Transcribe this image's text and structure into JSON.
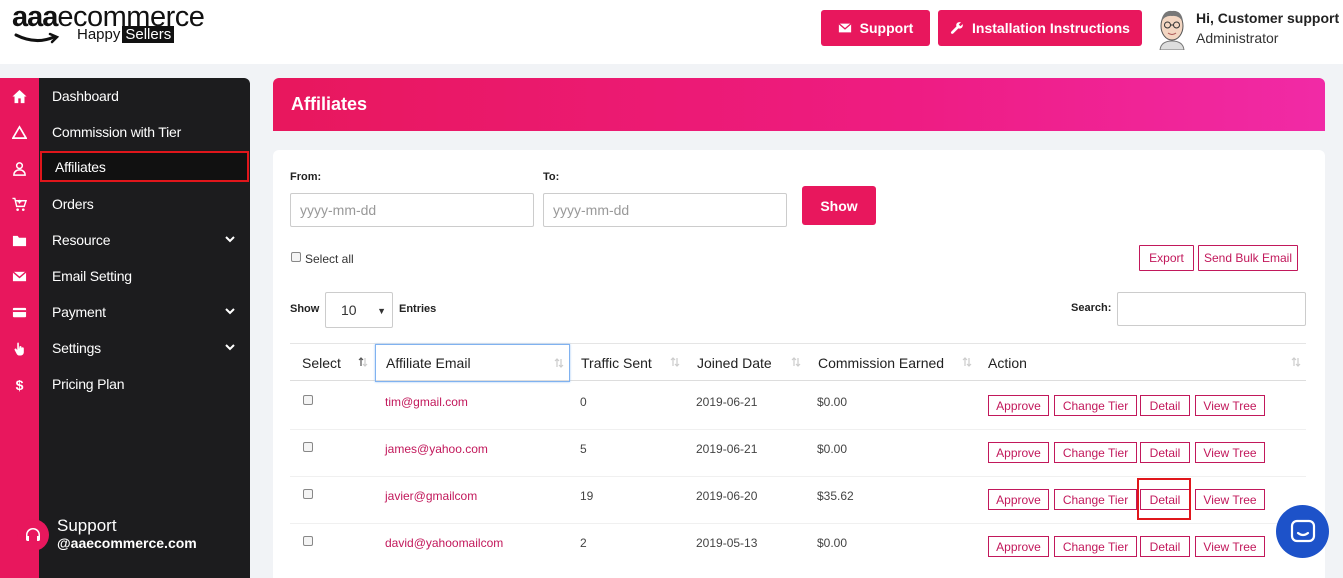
{
  "brand": {
    "main_bold": "aaa",
    "main_rest": "ecommerce",
    "sub_plain": "Happy",
    "sub_tag": "Sellers"
  },
  "header": {
    "support_label": "Support",
    "install_label": "Installation Instructions",
    "user_greeting": "Hi, Customer support",
    "user_role": "Administrator"
  },
  "sidebar": {
    "items": [
      {
        "label": "Dashboard",
        "icon": "home-icon"
      },
      {
        "label": "Commission with Tier",
        "icon": "triangle-icon"
      },
      {
        "label": "Affiliates",
        "icon": "user-icon",
        "active": true
      },
      {
        "label": "Orders",
        "icon": "cart-icon"
      },
      {
        "label": "Resource",
        "icon": "folder-icon",
        "expandable": true
      },
      {
        "label": "Email Setting",
        "icon": "envelope-icon"
      },
      {
        "label": "Payment",
        "icon": "credit-card-icon",
        "expandable": true
      },
      {
        "label": "Settings",
        "icon": "hand-pointer-icon",
        "expandable": true
      },
      {
        "label": "Pricing Plan",
        "icon": "dollar-icon"
      }
    ],
    "support_title": "Support",
    "support_email": "@aaecommerce.com"
  },
  "page": {
    "title": "Affiliates"
  },
  "filters": {
    "from_label": "From:",
    "to_label": "To:",
    "from_placeholder": "yyyy-mm-dd",
    "to_placeholder": "yyyy-mm-dd",
    "show_button": "Show",
    "select_all": "Select all",
    "export": "Export",
    "send_bulk_email": "Send Bulk Email"
  },
  "table_controls": {
    "show_label": "Show",
    "entries_value": "10",
    "entries_label": "Entries",
    "search_label": "Search:"
  },
  "table": {
    "columns": [
      "Select",
      "Affiliate Email",
      "Traffic Sent",
      "Joined Date",
      "Commission Earned",
      "Action"
    ],
    "rows": [
      {
        "email": "tim@gmail.com",
        "traffic": "0",
        "joined": "2019-06-21",
        "commission": "$0.00"
      },
      {
        "email": "james@yahoo.com",
        "traffic": "5",
        "joined": "2019-06-21",
        "commission": "$0.00"
      },
      {
        "email": "javier@gmailcom",
        "traffic": "19",
        "joined": "2019-06-20",
        "commission": "$35.62"
      },
      {
        "email": "david@yahoomailcom",
        "traffic": "2",
        "joined": "2019-05-13",
        "commission": "$0.00"
      }
    ],
    "actions": {
      "approve": "Approve",
      "change_tier": "Change Tier",
      "detail": "Detail",
      "view_tree": "View Tree"
    }
  },
  "colors": {
    "accent": "#e8175d",
    "sidebar_bg": "#1c1c1e",
    "chat_bubble": "#1d52c9",
    "highlight": "#e0161b"
  }
}
